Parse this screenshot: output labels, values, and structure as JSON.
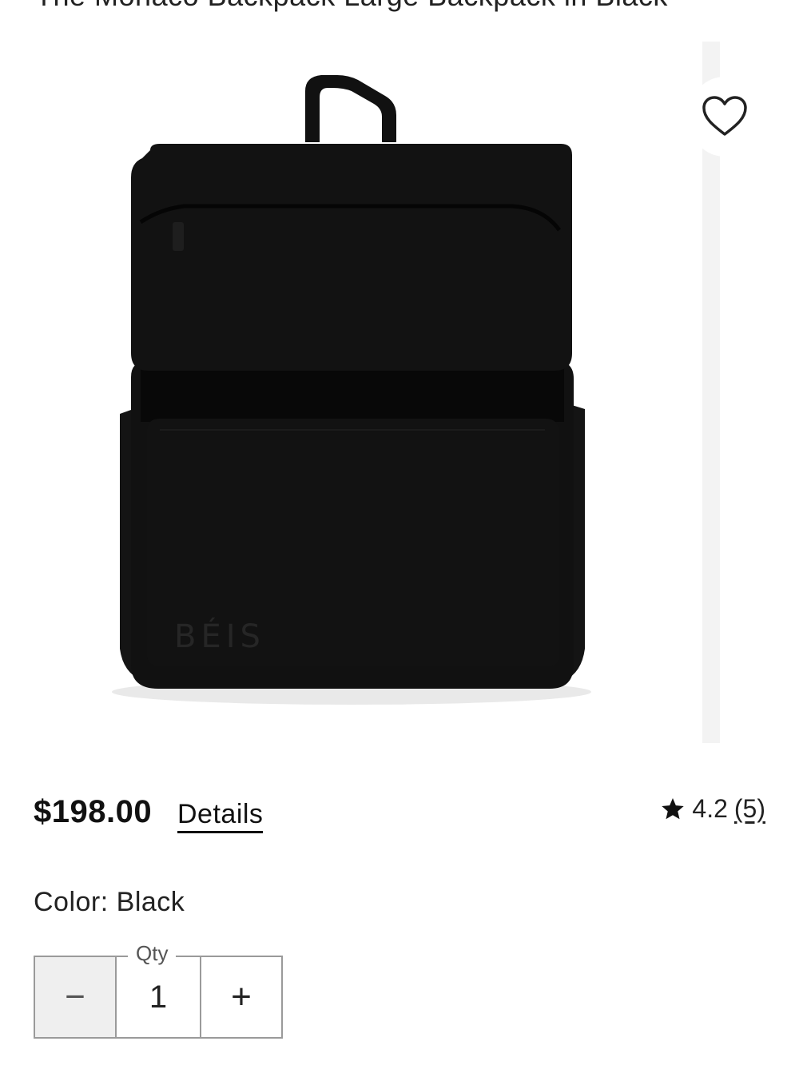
{
  "header": {
    "title": "The Monaco Backpack Large Backpack in Black"
  },
  "product": {
    "brand_mark": "BÉIS",
    "favorite_icon": "heart-outline-icon",
    "price": "$198.00",
    "details_label": "Details",
    "rating": {
      "icon": "star-icon",
      "value": "4.2",
      "count": "(5)"
    },
    "color": {
      "label": "Color:",
      "value": "Black"
    },
    "quantity": {
      "legend": "Qty",
      "value": "1",
      "decrement_label": "−",
      "increment_label": "+"
    }
  },
  "colors": {
    "product": "#0f0f0f",
    "text": "#111111",
    "border": "#9a9a9a",
    "disabled_bg": "#efefef"
  }
}
